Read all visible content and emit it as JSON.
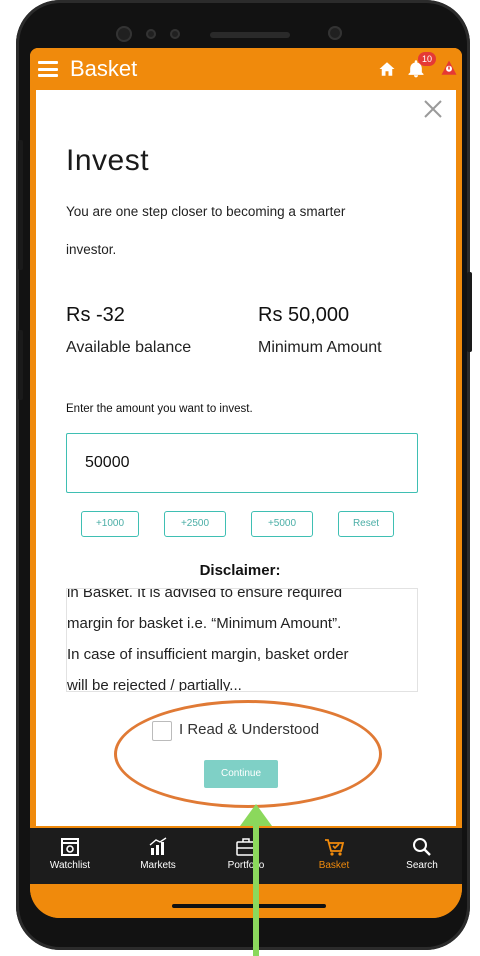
{
  "header": {
    "title": "Basket",
    "notification_count": "10"
  },
  "invest": {
    "heading": "Invest",
    "subtitle_line1": "You are one step closer to becoming a smarter",
    "subtitle_line2": "investor.",
    "balance_value": "Rs -32",
    "balance_label": "Available balance",
    "minimum_value": "Rs 50,000",
    "minimum_label": "Minimum Amount",
    "amount_prompt": "Enter the amount you want to invest.",
    "amount_value": "50000",
    "quick_buttons": [
      "+1000",
      "+2500",
      "+5000",
      "Reset"
    ],
    "disclaimer_title": "Disclaimer:",
    "disclaimer_lines": [
      "in Basket. It is advised to ensure required",
      "margin for basket i.e. “Minimum Amount”.",
      "In case of insufficient margin, basket order",
      "will be rejected / partially..."
    ],
    "checkbox_label": "I Read & Understood",
    "continue_label": "Continue"
  },
  "bottom_nav": [
    {
      "label": "Watchlist",
      "icon": "watchlist-icon"
    },
    {
      "label": "Markets",
      "icon": "markets-icon"
    },
    {
      "label": "Portfolio",
      "icon": "portfolio-icon"
    },
    {
      "label": "Basket",
      "icon": "basket-icon",
      "active": true
    },
    {
      "label": "Search",
      "icon": "search-icon"
    }
  ],
  "colors": {
    "brand_orange": "#f08a0c",
    "accent_teal": "#3fbfb3",
    "nav_bg": "#1c1c1c",
    "annotation_orange": "#e07a35",
    "annotation_green": "#8bd85c"
  }
}
